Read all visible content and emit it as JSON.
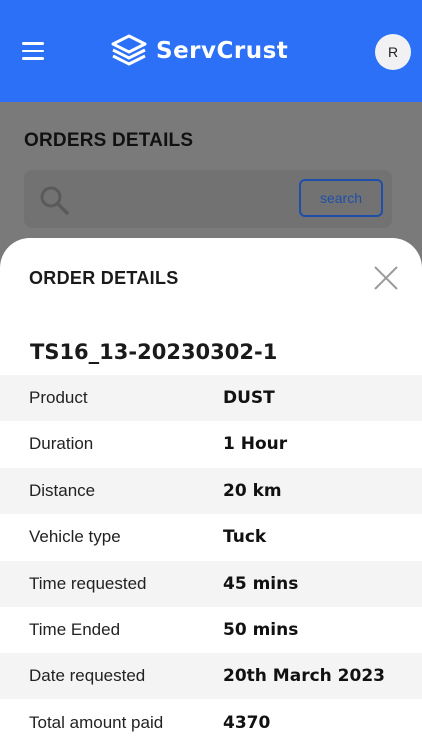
{
  "header": {
    "brand_name": "ServCrust",
    "avatar_initial": "R",
    "bar_color": "#2b70f6"
  },
  "page": {
    "title": "ORDERS DETAILS",
    "search": {
      "placeholder": "",
      "button_label": "search"
    }
  },
  "sheet": {
    "title": "ORDER DETAILS",
    "order_id": "TS16_13-20230302-1",
    "rows": [
      {
        "label": "Product",
        "value": "DUST"
      },
      {
        "label": "Duration",
        "value": "1 Hour"
      },
      {
        "label": "Distance",
        "value": "20 km"
      },
      {
        "label": "Vehicle type",
        "value": "Tuck"
      },
      {
        "label": "Time requested",
        "value": "45 mins"
      },
      {
        "label": "Time Ended",
        "value": "50 mins"
      },
      {
        "label": "Date requested",
        "value": "20th March 2023"
      },
      {
        "label": "Total amount paid",
        "value": "4370"
      }
    ]
  },
  "icons": {
    "menu": "hamburger-menu-icon",
    "logo": "servcrust-logo-icon",
    "search": "search-icon",
    "close": "close-icon"
  }
}
